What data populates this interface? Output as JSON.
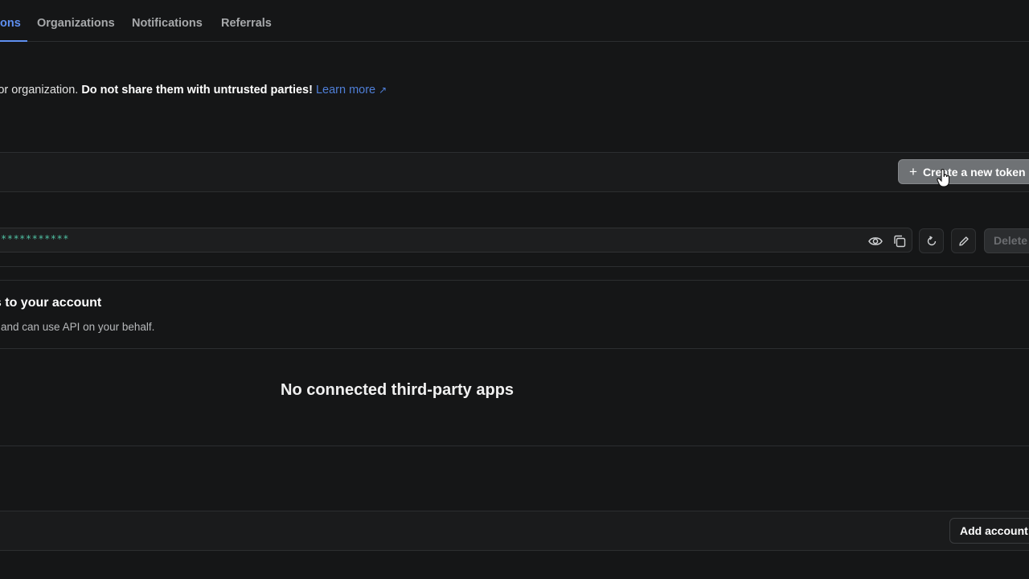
{
  "tabs": [
    {
      "label": "ons",
      "active": true
    },
    {
      "label": "Organizations",
      "active": false
    },
    {
      "label": "Notifications",
      "active": false
    },
    {
      "label": "Referrals",
      "active": false
    }
  ],
  "warning": {
    "text": "int or organization. ",
    "bold": "Do not share them with untrusted parties!",
    "link": "Learn more",
    "link_icon": "external-link-icon"
  },
  "tokens": {
    "create_label": "Create a new token",
    "create_icon": "plus-icon",
    "row": {
      "masked_value": "***********",
      "icons": [
        "eye-icon",
        "copy-icon",
        "refresh-icon",
        "edit-icon"
      ],
      "delete_label": "Delete"
    }
  },
  "connected_apps": {
    "title": "ss to your account",
    "subtitle": "nt and can use API on your behalf.",
    "empty": "No connected third-party apps"
  },
  "accounts": {
    "add_label": "Add account"
  },
  "colors": {
    "background": "#151617",
    "accent": "#5e8ff0",
    "token_text": "#4fc1a3"
  }
}
